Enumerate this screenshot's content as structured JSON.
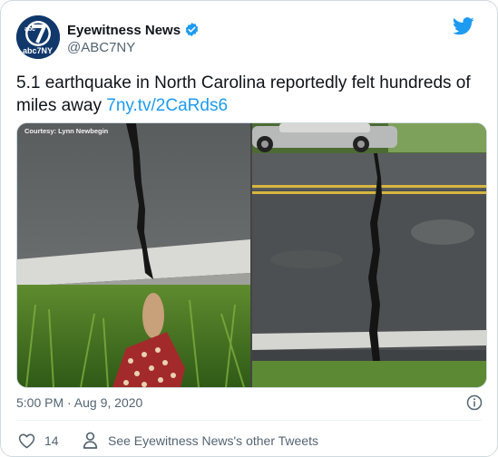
{
  "author": {
    "name": "Eyewitness News",
    "handle": "@ABC7NY",
    "verified": true,
    "avatar_logo_text": "abc7NY"
  },
  "tweet": {
    "text": "5.1 earthquake in North Carolina reportedly felt hundreds of miles away ",
    "link": "7ny.tv/2CaRds6"
  },
  "media": {
    "photos": [
      {
        "credit": "Courtesy: Lynn Newbegin",
        "depicts": "crack-in-asphalt-with-foot"
      },
      {
        "depicts": "crack-across-road-with-car"
      }
    ]
  },
  "meta": {
    "timestamp": "5:00 PM · Aug 9, 2020"
  },
  "actions": {
    "like_count": "14",
    "other_tweets_label": "See Eyewitness News's other Tweets"
  },
  "icons": {
    "brand": "twitter-bird-icon",
    "info": "info-icon",
    "like": "heart-icon",
    "profile": "user-icon"
  },
  "colors": {
    "twitter_blue": "#1d9bf0",
    "secondary_text": "#536471",
    "border": "#cfd9de",
    "abc7_navy": "#10386b"
  }
}
